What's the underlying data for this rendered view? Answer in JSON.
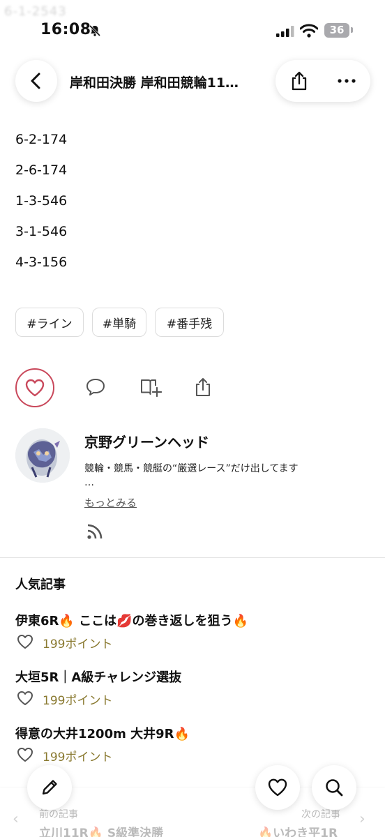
{
  "status_bar": {
    "ghost_text": "6-1-2543",
    "time": "16:08",
    "battery": "36"
  },
  "header": {
    "title": "岸和田決勝 岸和田競輪11…"
  },
  "content": {
    "lines": [
      "6-2-174",
      "2-6-174",
      "1-3-546",
      "3-1-546",
      "4-3-156"
    ]
  },
  "hashtags": [
    "#ライン",
    "#単騎",
    "#番手残"
  ],
  "author": {
    "name": "京野グリーンヘッド",
    "bio": "競輪・競馬・競艇の“厳選レース”だけ出してます",
    "ellipsis": "…",
    "more_label": "もっとみる"
  },
  "popular": {
    "heading": "人気記事",
    "items": [
      {
        "title": "伊東6R🔥 ここは💋の巻き返しを狙う🔥",
        "points": "199ポイント"
      },
      {
        "title": "大垣5R｜A級チャレンジ選抜",
        "points": "199ポイント"
      },
      {
        "title": "得意の大井1200m 大井9R🔥",
        "points": "199ポイント"
      }
    ]
  },
  "bottom_nav": {
    "prev_label": "前の記事",
    "prev_title": "立川11R🔥 S級準決勝",
    "next_label": "次の記事",
    "next_title": "🔥いわき平1R"
  },
  "colors": {
    "accent_like": "#c9485b",
    "points": "#8a7a31"
  }
}
